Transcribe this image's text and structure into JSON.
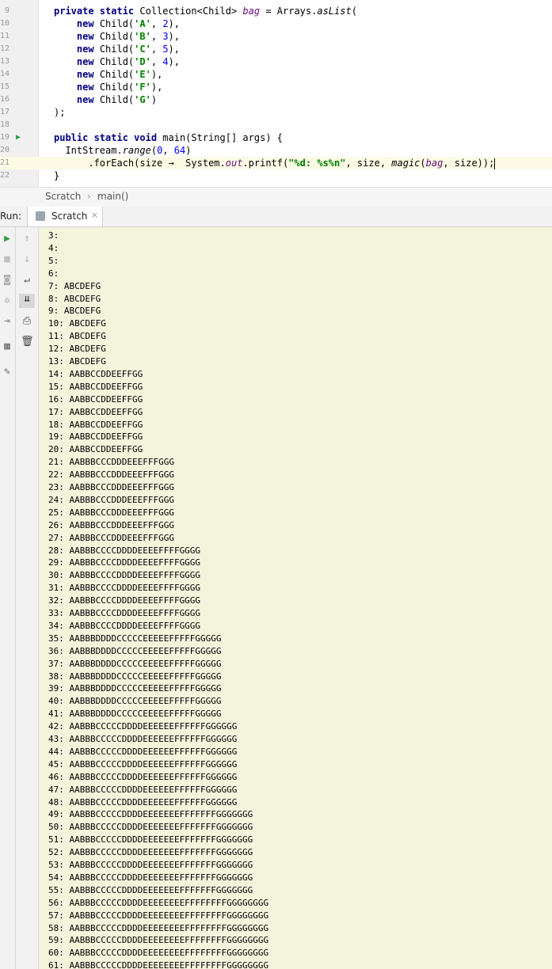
{
  "editor": {
    "lines": [
      {
        "ln": "9",
        "parts": [
          [
            "kw",
            "private static "
          ],
          [
            "",
            "Collection<Child> "
          ],
          [
            "fld",
            "bag"
          ],
          [
            "",
            " = Arrays."
          ],
          [
            "ital",
            "asList"
          ],
          [
            "",
            "("
          ]
        ],
        "indent": ""
      },
      {
        "ln": "10",
        "parts": [
          [
            "kw",
            "new "
          ],
          [
            "",
            "Child("
          ],
          [
            "str",
            "'A'"
          ],
          [
            "",
            ", "
          ],
          [
            "num",
            "2"
          ],
          [
            "",
            "),"
          ]
        ],
        "indent": "    "
      },
      {
        "ln": "11",
        "parts": [
          [
            "kw",
            "new "
          ],
          [
            "",
            "Child("
          ],
          [
            "str",
            "'B'"
          ],
          [
            "",
            ", "
          ],
          [
            "num",
            "3"
          ],
          [
            "",
            "),"
          ]
        ],
        "indent": "    "
      },
      {
        "ln": "12",
        "parts": [
          [
            "kw",
            "new "
          ],
          [
            "",
            "Child("
          ],
          [
            "str",
            "'C'"
          ],
          [
            "",
            ", "
          ],
          [
            "num",
            "5"
          ],
          [
            "",
            "),"
          ]
        ],
        "indent": "    "
      },
      {
        "ln": "13",
        "parts": [
          [
            "kw",
            "new "
          ],
          [
            "",
            "Child("
          ],
          [
            "str",
            "'D'"
          ],
          [
            "",
            ", "
          ],
          [
            "num",
            "4"
          ],
          [
            "",
            "),"
          ]
        ],
        "indent": "    "
      },
      {
        "ln": "14",
        "parts": [
          [
            "kw",
            "new "
          ],
          [
            "",
            "Child("
          ],
          [
            "str",
            "'E'"
          ],
          [
            "",
            "),"
          ]
        ],
        "indent": "    "
      },
      {
        "ln": "15",
        "parts": [
          [
            "kw",
            "new "
          ],
          [
            "",
            "Child("
          ],
          [
            "str",
            "'F'"
          ],
          [
            "",
            "),"
          ]
        ],
        "indent": "    "
      },
      {
        "ln": "16",
        "parts": [
          [
            "kw",
            "new "
          ],
          [
            "",
            "Child("
          ],
          [
            "str",
            "'G'"
          ],
          [
            "",
            ")"
          ]
        ],
        "indent": "    "
      },
      {
        "ln": "17",
        "parts": [
          [
            "",
            ");"
          ]
        ],
        "indent": ""
      },
      {
        "ln": "18",
        "parts": [],
        "indent": ""
      },
      {
        "ln": "19",
        "parts": [
          [
            "kw",
            "public static void "
          ],
          [
            "",
            "main(String[] args) {"
          ]
        ],
        "indent": "",
        "run": true
      },
      {
        "ln": "20",
        "parts": [
          [
            "",
            "IntStream."
          ],
          [
            "ital",
            "range"
          ],
          [
            "",
            "("
          ],
          [
            "num",
            "0"
          ],
          [
            "",
            ", "
          ],
          [
            "num",
            "64"
          ],
          [
            "",
            ")"
          ]
        ],
        "indent": "  "
      },
      {
        "ln": "21",
        "parts": [
          [
            "",
            ".forEach(size →  System."
          ],
          [
            "fld",
            "out"
          ],
          [
            "",
            ".printf("
          ],
          [
            "str",
            "\"%d: %s%n\""
          ],
          [
            "",
            ", size, "
          ],
          [
            "ital",
            "magic"
          ],
          [
            "",
            "("
          ],
          [
            "fld",
            "bag"
          ],
          [
            "",
            ", size));"
          ]
        ],
        "indent": "      ",
        "caret": true
      },
      {
        "ln": "22",
        "parts": [
          [
            "",
            "}"
          ]
        ],
        "indent": ""
      }
    ]
  },
  "breadcrumb": {
    "file": "Scratch",
    "sep": "›",
    "method": "main()"
  },
  "run_panel": {
    "label": "Run:",
    "tab": "Scratch",
    "close": "×"
  },
  "toolbar_left": [
    "rerun-icon",
    "stop-icon",
    "snapshot-icon",
    "settings-icon",
    "exit-icon",
    "layout-icon",
    "pin-icon"
  ],
  "toolbar_right": [
    "up-arrow-icon",
    "down-arrow-icon",
    "soft-wrap-icon",
    "scroll-to-end-icon",
    "print-icon",
    "trash-icon"
  ],
  "output": [
    "3:",
    "4:",
    "5:",
    "6:",
    "7: ABCDEFG",
    "8: ABCDEFG",
    "9: ABCDEFG",
    "10: ABCDEFG",
    "11: ABCDEFG",
    "12: ABCDEFG",
    "13: ABCDEFG",
    "14: AABBCCDDEEFFGG",
    "15: AABBCCDDEEFFGG",
    "16: AABBCCDDEEFFGG",
    "17: AABBCCDDEEFFGG",
    "18: AABBCCDDEEFFGG",
    "19: AABBCCDDEEFFGG",
    "20: AABBCCDDEEFFGG",
    "21: AABBBCCCDDDEEEFFFGGG",
    "22: AABBBCCCDDDEEEFFFGGG",
    "23: AABBBCCCDDDEEEFFFGGG",
    "24: AABBBCCCDDDEEEFFFGGG",
    "25: AABBBCCCDDDEEEFFFGGG",
    "26: AABBBCCCDDDEEEFFFGGG",
    "27: AABBBCCCDDDEEEFFFGGG",
    "28: AABBBCCCCDDDDEEEEFFFFGGGG",
    "29: AABBBCCCCDDDDEEEEFFFFGGGG",
    "30: AABBBCCCCDDDDEEEEFFFFGGGG",
    "31: AABBBCCCCDDDDEEEEFFFFGGGG",
    "32: AABBBCCCCDDDDEEEEFFFFGGGG",
    "33: AABBBCCCCDDDDEEEEFFFFGGGG",
    "34: AABBBCCCCDDDDEEEEFFFFGGGG",
    "35: AABBBDDDDCCCCCEEEEEFFFFFGGGGG",
    "36: AABBBDDDDCCCCCEEEEEFFFFFGGGGG",
    "37: AABBBDDDDCCCCCEEEEEFFFFFGGGGG",
    "38: AABBBDDDDCCCCCEEEEEFFFFFGGGGG",
    "39: AABBBDDDDCCCCCEEEEEFFFFFGGGGG",
    "40: AABBBDDDDCCCCCEEEEEFFFFFGGGGG",
    "41: AABBBDDDDCCCCCEEEEEFFFFFGGGGG",
    "42: AABBBCCCCCDDDDEEEEEEFFFFFFGGGGGG",
    "43: AABBBCCCCCDDDDEEEEEEFFFFFFGGGGGG",
    "44: AABBBCCCCCDDDDEEEEEEFFFFFFGGGGGG",
    "45: AABBBCCCCCDDDDEEEEEEFFFFFFGGGGGG",
    "46: AABBBCCCCCDDDDEEEEEEFFFFFFGGGGGG",
    "47: AABBBCCCCCDDDDEEEEEEFFFFFFGGGGGG",
    "48: AABBBCCCCCDDDDEEEEEEFFFFFFGGGGGG",
    "49: AABBBCCCCCDDDDEEEEEEEFFFFFFFGGGGGGG",
    "50: AABBBCCCCCDDDDEEEEEEEFFFFFFFGGGGGGG",
    "51: AABBBCCCCCDDDDEEEEEEEFFFFFFFGGGGGGG",
    "52: AABBBCCCCCDDDDEEEEEEEFFFFFFFGGGGGGG",
    "53: AABBBCCCCCDDDDEEEEEEEFFFFFFFGGGGGGG",
    "54: AABBBCCCCCDDDDEEEEEEEFFFFFFFGGGGGGG",
    "55: AABBBCCCCCDDDDEEEEEEEFFFFFFFGGGGGGG",
    "56: AABBBCCCCCDDDDEEEEEEEEFFFFFFFFGGGGGGGG",
    "57: AABBBCCCCCDDDDEEEEEEEEFFFFFFFFGGGGGGGG",
    "58: AABBBCCCCCDDDDEEEEEEEEFFFFFFFFGGGGGGGG",
    "59: AABBBCCCCCDDDDEEEEEEEEFFFFFFFFGGGGGGGG",
    "60: AABBBCCCCCDDDDEEEEEEEEFFFFFFFFGGGGGGGG",
    "61: AABBBCCCCCDDDDEEEEEEEEFFFFFFFFGGGGGGGG"
  ]
}
